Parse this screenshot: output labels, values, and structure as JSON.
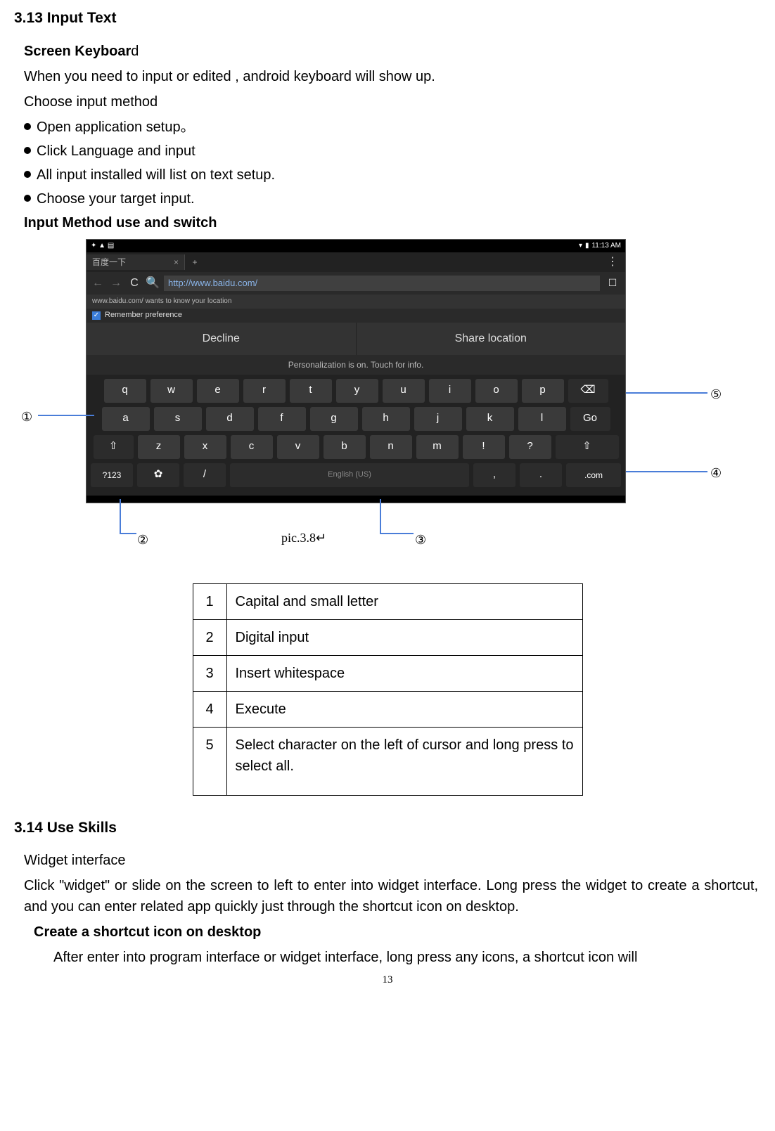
{
  "section313": {
    "heading": "3.13 Input Text",
    "screen_keyboard_bold": "Screen Keyboar",
    "screen_keyboard_tail": "d",
    "line1": "When you need to input or edited , android keyboard will show up.",
    "line2": "Choose input method",
    "bullets": [
      "Open application setup。",
      "Click Language and input",
      "All input installed will list on text setup.",
      "Choose your target input."
    ],
    "input_method_heading": "Input Method use and switch"
  },
  "screenshot": {
    "status_left": "✦ ▲ ▤",
    "status_right_time": "11:13 AM",
    "tab_title": "百度一下",
    "url": "http://www.baidu.com/",
    "loc_msg": "www.baidu.com/ wants to know your location",
    "remember": "Remember preference",
    "decline": "Decline",
    "share": "Share location",
    "personalize": "Personalization is on. Touch for info.",
    "row1": [
      "q",
      "w",
      "e",
      "r",
      "t",
      "y",
      "u",
      "i",
      "o",
      "p"
    ],
    "row2": [
      "a",
      "s",
      "d",
      "f",
      "g",
      "h",
      "j",
      "k",
      "l"
    ],
    "row3": [
      "z",
      "x",
      "c",
      "v",
      "b",
      "n",
      "m",
      "!",
      "?"
    ],
    "go": "Go",
    "num": "?123",
    "gear": "✿",
    "slash": "/",
    "space": "English (US)",
    "comma": ",",
    "dot": ".",
    "dotcom": ".com",
    "shift": "⇧",
    "backspace": "⌫",
    "caption": "pic.3.8↵"
  },
  "callouts": {
    "c1": "①",
    "c2": "②",
    "c3": "③",
    "c4": "④",
    "c5": "⑤"
  },
  "legend": {
    "r1": {
      "n": "1",
      "t": "Capital and small letter"
    },
    "r2": {
      "n": "2",
      "t": "Digital input"
    },
    "r3": {
      "n": "3",
      "t": "Insert whitespace"
    },
    "r4": {
      "n": "4",
      "t": "Execute"
    },
    "r5": {
      "n": "5",
      "t": "Select character on the left of cursor and long press to select all."
    }
  },
  "section314": {
    "heading": "3.14 Use Skills",
    "widget_heading": "Widget interface",
    "widget_body": "Click \"widget\" or slide on the screen to left to enter into widget interface. Long press the widget to create a shortcut, and you can enter related app quickly just through the shortcut icon on desktop.",
    "shortcut_heading": "Create a shortcut icon on desktop",
    "shortcut_body": "After enter into program interface or widget interface, long press any icons, a shortcut icon will"
  },
  "page_number": "13"
}
